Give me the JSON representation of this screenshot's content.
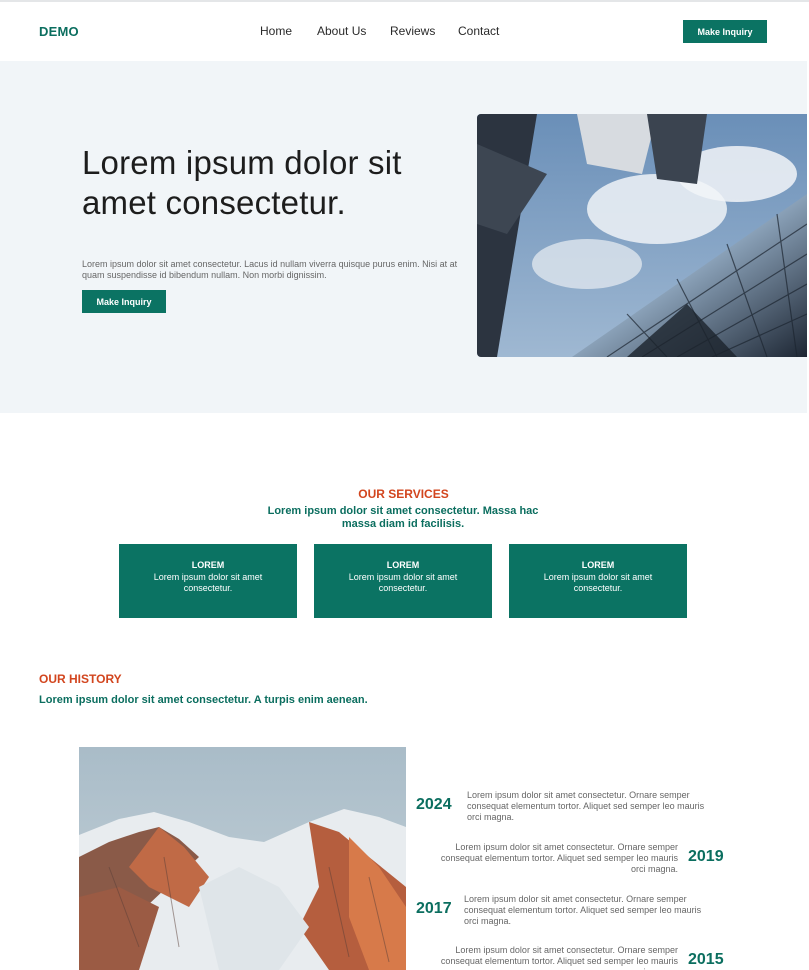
{
  "colors": {
    "brand": "#0b7363",
    "accent": "#d2451e",
    "hero_bg": "#f1f5f8"
  },
  "header": {
    "logo": "DEMO",
    "nav": [
      "Home",
      "About Us",
      "Reviews",
      "Contact"
    ],
    "cta_label": "Make Inquiry"
  },
  "hero": {
    "title": "Lorem ipsum dolor sit amet consectetur.",
    "text": "Lorem ipsum dolor sit amet consectetur. Lacus id nullam viverra quisque purus enim. Nisi at at quam suspendisse id bibendum nullam. Non morbi dignissim.",
    "cta_label": "Make Inquiry"
  },
  "services": {
    "title": "OUR SERVICES",
    "subtitle": "Lorem ipsum dolor sit amet consectetur. Massa hac massa diam id facilisis.",
    "cards": [
      {
        "title": "LOREM",
        "text": "Lorem ipsum dolor sit amet consectetur."
      },
      {
        "title": "LOREM",
        "text": "Lorem ipsum dolor sit amet consectetur."
      },
      {
        "title": "LOREM",
        "text": "Lorem ipsum dolor sit amet consectetur."
      }
    ]
  },
  "history": {
    "title": "OUR HISTORY",
    "subtitle": "Lorem ipsum dolor sit amet consectetur. A turpis enim aenean.",
    "timeline": [
      {
        "year": "2024",
        "text": "Lorem ipsum dolor sit amet consectetur. Ornare semper consequat elementum tortor. Aliquet sed semper leo mauris orci magna."
      },
      {
        "year": "2019",
        "text": "Lorem ipsum dolor sit amet consectetur. Ornare semper consequat elementum tortor. Aliquet sed semper leo mauris orci magna."
      },
      {
        "year": "2017",
        "text": "Lorem ipsum dolor sit amet consectetur. Ornare semper consequat elementum tortor. Aliquet sed semper leo mauris orci magna."
      },
      {
        "year": "2015",
        "text": "Lorem ipsum dolor sit amet consectetur. Ornare semper consequat elementum tortor. Aliquet sed semper leo mauris orci magna."
      }
    ]
  }
}
